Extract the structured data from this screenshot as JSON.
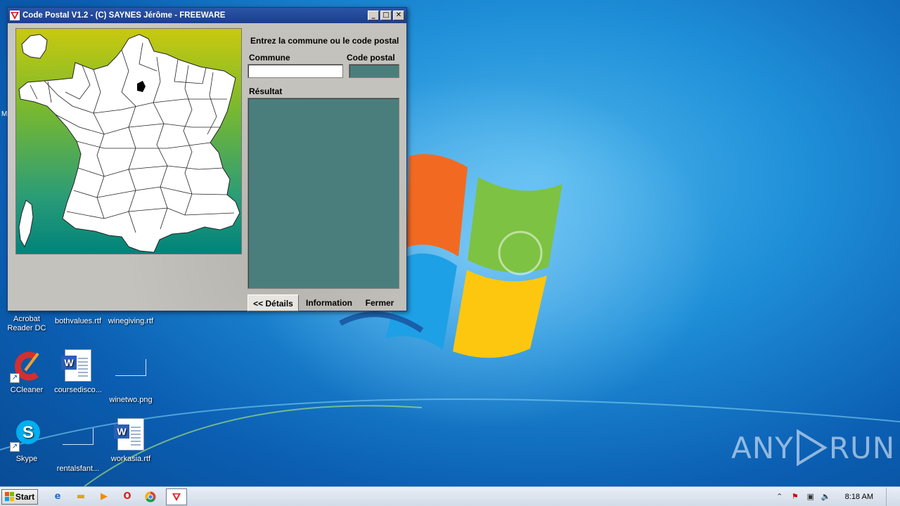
{
  "window": {
    "title": "Code Postal V1.2 - (C) SAYNES Jérôme - FREEWARE",
    "controls": {
      "minimize": "_",
      "maximize": "□",
      "close": "✕"
    }
  },
  "form": {
    "instruction": "Entrez la commune ou le code postal",
    "commune_label": "Commune",
    "commune_value": "",
    "code_postal_label": "Code postal",
    "code_postal_value": "",
    "result_label": "Résultat",
    "result_value": ""
  },
  "buttons": {
    "details": "<< Détails",
    "information": "Information",
    "fermer": "Fermer"
  },
  "map": {
    "highlighted_department_color": "#000000",
    "background_colors": [
      "#c9c90f",
      "#7ab92e",
      "#2a9c78",
      "#00837a"
    ]
  },
  "desktop": {
    "icons_row1": [
      {
        "label": "Acrobat\nReader DC"
      },
      {
        "label": "bothvalues.rtf"
      },
      {
        "label": "winegiving.rtf"
      }
    ],
    "icons_row2": [
      {
        "label": "CCleaner",
        "icon": "ccleaner-icon"
      },
      {
        "label": "coursedisco...",
        "icon": "word-doc-icon"
      },
      {
        "label": "winetwo.png",
        "icon": "image-icon"
      }
    ],
    "icons_row3": [
      {
        "label": "Skype",
        "icon": "skype-icon"
      },
      {
        "label": "rentalsfant...",
        "icon": "image-icon"
      },
      {
        "label": "workasia.rtf",
        "icon": "word-doc-icon"
      }
    ],
    "edge_text": "M"
  },
  "taskbar": {
    "start_label": "Start",
    "clock": "8:18 AM",
    "pinned": [
      "ie-icon",
      "explorer-icon",
      "media-player-icon",
      "opera-icon",
      "chrome-icon",
      "code-postal-icon"
    ]
  },
  "watermark": {
    "left": "ANY",
    "right": "RUN"
  }
}
